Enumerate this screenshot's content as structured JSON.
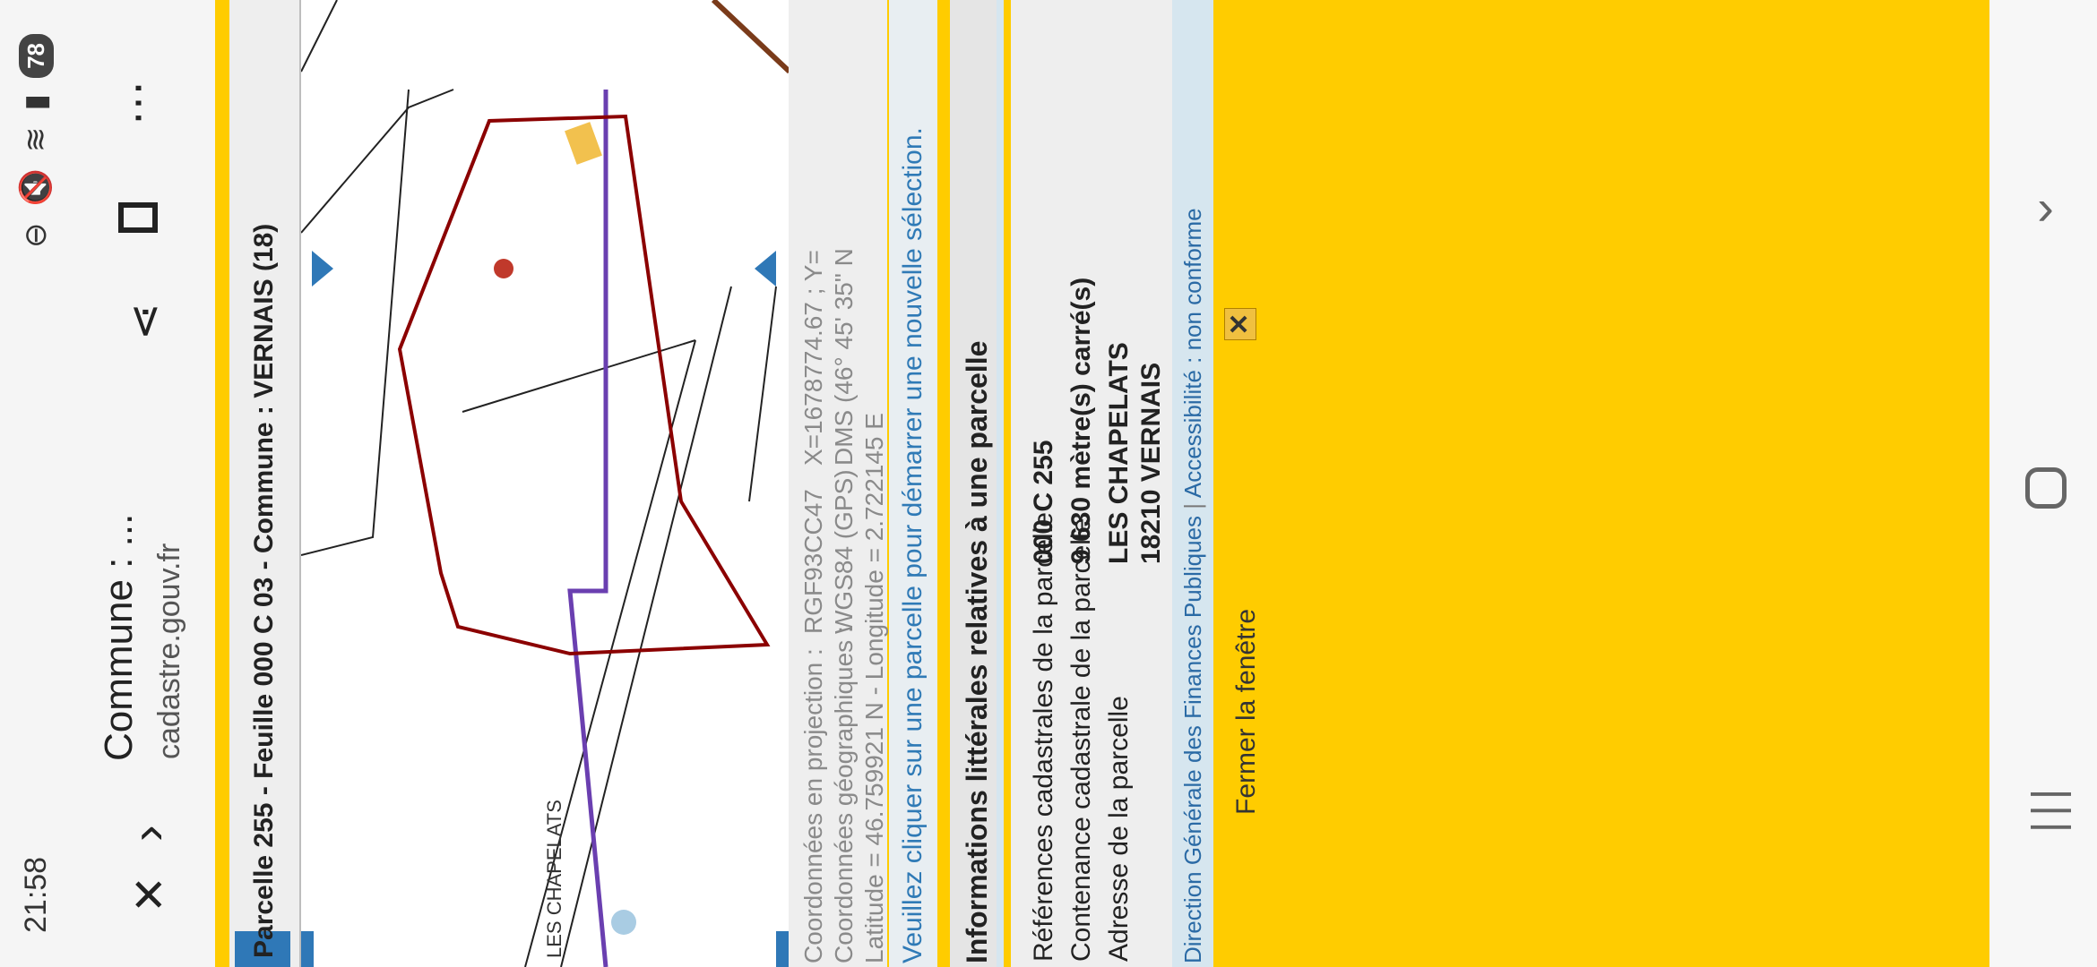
{
  "status": {
    "time": "21:58",
    "battery": "78"
  },
  "browser": {
    "title": "Commune : ...",
    "url": "cadastre.gouv.fr",
    "close_icon": "close-icon",
    "forward_icon": "chevron-right-icon",
    "share_icon": "share-icon",
    "bookmark_icon": "bookmark-icon",
    "more_icon": "more-vert-icon"
  },
  "header": {
    "title": "Parcelle 255 - Feuille 000 C 03 - Commune : VERNAIS (18)"
  },
  "map": {
    "place_label": "LES CHAPELATS"
  },
  "coords": {
    "projection_label": "Coordonnées en projection :",
    "projection_system": "RGF93CC47",
    "projection_value": "X=1678774.67 ; Y=",
    "geo_label": "Coordonnées géographiques :",
    "geo_system": "WGS84 (GPS)",
    "geo_value": "DMS (46° 45' 35\" N",
    "decimal": "Latitude = 46.759921 N - Longitude = 2.722145 E"
  },
  "hint": "Veuillez cliquer sur une parcelle pour démarrer une nouvelle sélection.",
  "info": {
    "title": "Informations littérales relatives à une parcelle",
    "rows": [
      {
        "label": "Références cadastrales de la parcelle",
        "value": "000 C 255"
      },
      {
        "label": "Contenance cadastrale de la parcelle",
        "value": "9 630 mètre(s) carré(s)"
      },
      {
        "label": "Adresse de la parcelle",
        "value": "LES CHAPELATS"
      },
      {
        "label": "",
        "value": "18210 VERNAIS"
      }
    ]
  },
  "footer": {
    "dgfip": "Direction Générale des Finances Publiques",
    "separator": "|",
    "accessibility": "Accessibilité : non conforme"
  },
  "close": {
    "label": "Fermer la fenêtre",
    "x": "✕"
  },
  "colors": {
    "frame": "#ffcc00",
    "parcel": "#8b0000",
    "commune_border": "#6a3fb0",
    "link": "#2f7ab6"
  }
}
